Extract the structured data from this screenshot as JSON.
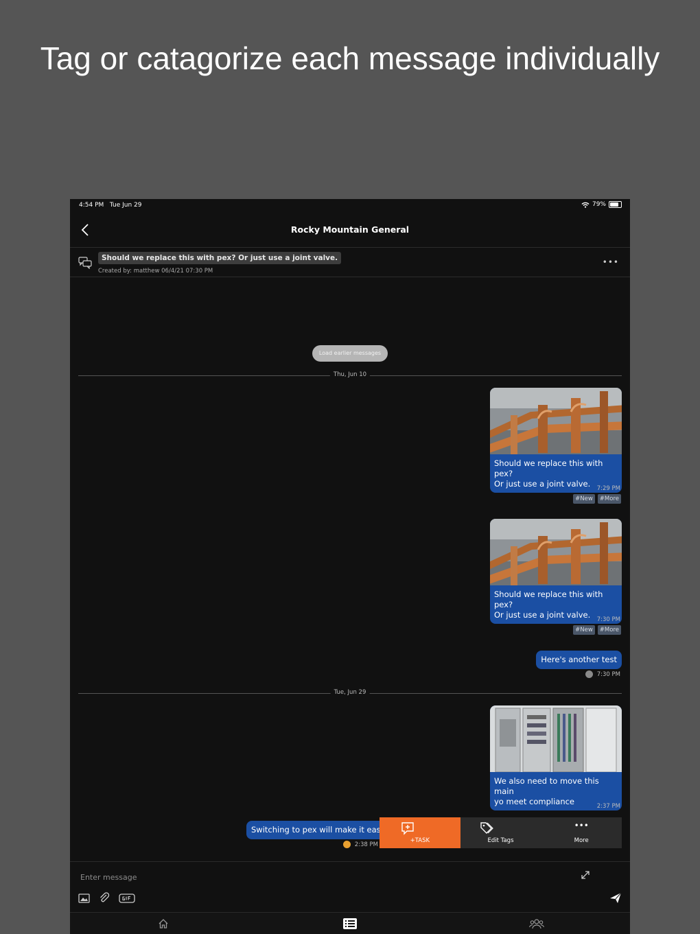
{
  "headline": "Tag or catagorize each message individually",
  "status": {
    "time": "4:54 PM",
    "date": "Tue Jun 29",
    "battery": "79%",
    "battery_level": 0.79
  },
  "nav": {
    "title": "Rocky Mountain General",
    "back_icon": "chevron-left-icon"
  },
  "thread": {
    "title": "Should we replace this with pex? Or just use a joint valve.",
    "created": "Created by: matthew 06/4/21 07:30 PM",
    "more_icon": "ellipsis-icon"
  },
  "load_earlier": "Load earlier messages",
  "dividers": [
    "Thu, Jun 10",
    "Tue, Jun 29"
  ],
  "messages": [
    {
      "type": "image",
      "image": "copper-pipes-photo",
      "caption_1": "Should we replace this with pex?",
      "caption_2": "Or just use a joint valve.",
      "time": "7:29 PM",
      "tags": [
        "#New",
        "#More"
      ]
    },
    {
      "type": "image",
      "image": "copper-pipes-photo",
      "caption_1": "Should we replace this with pex?",
      "caption_2": "Or just use a joint valve.",
      "time": "7:30 PM",
      "tags": [
        "#New",
        "#More"
      ]
    },
    {
      "type": "text",
      "text": "Here's another test",
      "time": "7:30 PM"
    },
    {
      "type": "image",
      "image": "electrical-panel-photo",
      "caption_1": "We also need to move this main",
      "caption_2": "yo meet compliance",
      "time": "2:37 PM"
    },
    {
      "type": "text",
      "text": "Switching to pex will make it easy",
      "time": "2:38 PM"
    }
  ],
  "actions": [
    {
      "label": "+TASK",
      "icon": "add-task-icon"
    },
    {
      "label": "Edit Tags",
      "icon": "tag-icon"
    },
    {
      "label": "More",
      "icon": "ellipsis-icon"
    }
  ],
  "composer": {
    "placeholder": "Enter message"
  },
  "tabs": [
    "home-icon",
    "list-icon",
    "people-icon"
  ],
  "colors": {
    "bubble": "#1b4fa3",
    "accent": "#ef6a26",
    "tag": "#4a5668",
    "background": "#111111"
  }
}
